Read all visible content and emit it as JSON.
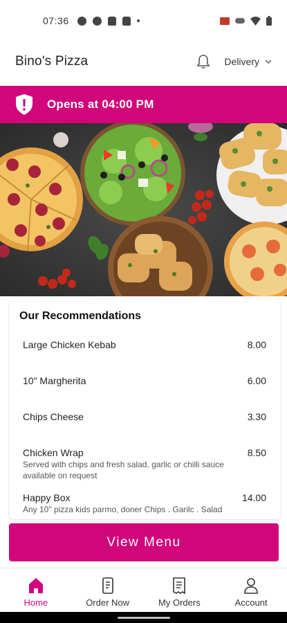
{
  "status_bar": {
    "time": "07:36",
    "left_icons": [
      "data-saver-icon",
      "messenger-icon",
      "android-icon",
      "android-icon",
      "dot-icon"
    ],
    "right_icons": [
      "cast-icon",
      "link-icon",
      "wifi-icon",
      "battery-icon"
    ]
  },
  "header": {
    "title": "Bino's Pizza",
    "bell_icon": "bell-icon",
    "delivery_label": "Delivery"
  },
  "banner": {
    "text": "Opens at 04:00 PM",
    "icon": "alert-shield-icon"
  },
  "hero": {
    "image": "pizza-table-spread"
  },
  "recommendations": {
    "title": "Our Recommendations",
    "items": [
      {
        "name": "Large Chicken Kebab",
        "price": "8.00",
        "desc": ""
      },
      {
        "name": "10\" Margherita",
        "price": "6.00",
        "desc": ""
      },
      {
        "name": "Chips Cheese",
        "price": "3.30",
        "desc": ""
      },
      {
        "name": "Chicken Wrap",
        "price": "8.50",
        "desc": "Served with chips and fresh salad, garlic or chilli sauce available on request"
      },
      {
        "name": "Happy Box",
        "price": "14.00",
        "desc": "Any 10\" pizza  kids parmo, doner Chips . Garilc . Salad"
      }
    ]
  },
  "view_menu_label": "View Menu",
  "bottom_nav": [
    {
      "label": "Home",
      "icon": "home-icon",
      "active": true
    },
    {
      "label": "Order Now",
      "icon": "order-clipboard-icon",
      "active": false
    },
    {
      "label": "My Orders",
      "icon": "receipt-icon",
      "active": false
    },
    {
      "label": "Account",
      "icon": "account-icon",
      "active": false
    }
  ],
  "colors": {
    "accent": "#d1067a",
    "text": "#222222",
    "muted": "#555555"
  }
}
